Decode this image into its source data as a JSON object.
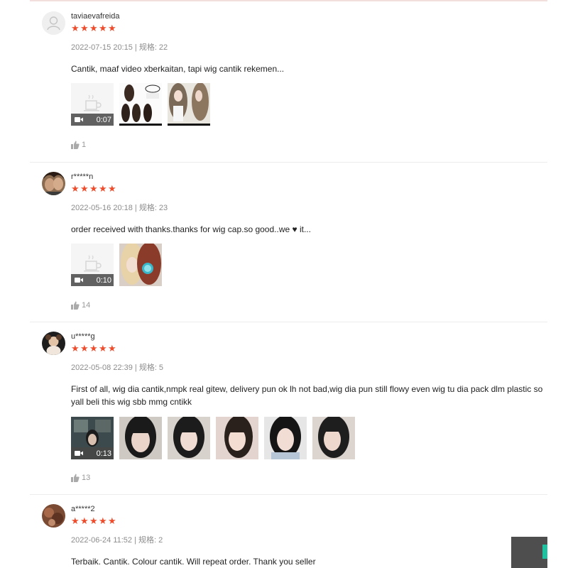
{
  "reviews": [
    {
      "username": "taviaevafreida",
      "rating": 5,
      "meta": "2022-07-15 20:15 | 规格: 22",
      "comment": "Cantik, maaf video xberkaitan, tapi wig cantik rekemen...",
      "video_duration": "0:07",
      "photo_count": 2,
      "likes": "1"
    },
    {
      "username": "r*****n",
      "rating": 5,
      "meta": "2022-05-16 20:18 | 规格: 23",
      "comment": "order received with thanks.thanks for wig cap.so good..we ♥ it...",
      "video_duration": "0:10",
      "photo_count": 1,
      "likes": "14"
    },
    {
      "username": "u*****g",
      "rating": 5,
      "meta": "2022-05-08 22:39 | 规格: 5",
      "comment": "First of all, wig dia cantik,nmpk real gitew, delivery pun ok lh not bad,wig dia pun still flowy even wig tu dia pack dlm plastic so yall beli this wig sbb mmg cntikk",
      "video_duration": "0:13",
      "photo_count": 5,
      "likes": "13"
    },
    {
      "username": "a*****2",
      "rating": 5,
      "meta": "2022-06-24 11:52 | 规格: 2",
      "comment": "Terbaik.  Cantik.  Colour cantik.  Will repeat order. Thank you seller"
    }
  ],
  "colors": {
    "star": "#ee4d2d",
    "meta": "#8c8c8c",
    "widget": "#4e4e4e",
    "widget_accent": "#1ec2a0"
  },
  "icons": {
    "like": "thumbs-up-icon",
    "video": "video-camera-icon",
    "placeholder": "cup-icon",
    "default_avatar": "user-icon"
  }
}
